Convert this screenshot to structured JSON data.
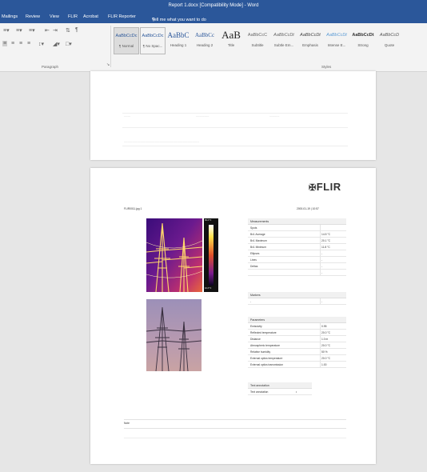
{
  "window": {
    "title": "Report 1.docx [Compatibility Mode] - Word"
  },
  "menu": {
    "items": [
      "Mailings",
      "Review",
      "View",
      "FLIR",
      "Acrobat",
      "FLIR Reporter"
    ],
    "tell_me": "Tell me what you want to do"
  },
  "ribbon": {
    "paragraph_label": "Paragraph",
    "styles_label": "Styles",
    "styles": [
      {
        "sample": "AaBbCcDc",
        "name": "¶ Normal"
      },
      {
        "sample": "AaBbCcDc",
        "name": "¶ No Spac..."
      },
      {
        "sample": "AaBbC",
        "name": "Heading 1"
      },
      {
        "sample": "AaBbCc",
        "name": "Heading 2"
      },
      {
        "sample": "AaB",
        "name": "Title"
      },
      {
        "sample": "AaBbCcC",
        "name": "Subtitle"
      },
      {
        "sample": "AaBbCcDt",
        "name": "Subtle Em..."
      },
      {
        "sample": "AaBbCcDt",
        "name": "Emphasis"
      },
      {
        "sample": "AaBbCcDt",
        "name": "Intense E..."
      },
      {
        "sample": "AaBbCcDt",
        "name": "Strong"
      },
      {
        "sample": "AaBbCcD",
        "name": "Quote"
      }
    ]
  },
  "report": {
    "logo": "FLIR",
    "file_name": "FLIR0011.jpg",
    "page_num": "1",
    "datetime": "2000-01-19 | 10:57",
    "scale_max": "36.4 °C",
    "scale_min": "10.3 °C",
    "measurements": {
      "title": "Measurements",
      "rows": [
        {
          "label": "Spots",
          "value": ""
        },
        {
          "label": "Bx1 Average",
          "value": "14.5 °C"
        },
        {
          "label": "Bx1 Maximum",
          "value": "20.1 °C"
        },
        {
          "label": "Bx1 Minimum",
          "value": "11.8 °C"
        },
        {
          "label": "Ellipses",
          "value": "-"
        },
        {
          "label": "Lines",
          "value": "-"
        },
        {
          "label": "Deltas",
          "value": "-"
        },
        {
          "label": "",
          "value": "-"
        }
      ]
    },
    "markers": {
      "title": "Markers",
      "rows": [
        {
          "label": "-",
          "value": "-"
        }
      ]
    },
    "parameters": {
      "title": "Parameters",
      "rows": [
        {
          "label": "Emissivity",
          "value": "0.95"
        },
        {
          "label": "Reflected temperature",
          "value": "20.0 °C"
        },
        {
          "label": "Distance",
          "value": "1.0 m"
        },
        {
          "label": "Atmospheric temperature",
          "value": "20.0 °C"
        },
        {
          "label": "Relative humidity",
          "value": "50 %"
        },
        {
          "label": "External optics temperature",
          "value": "20.0 °C"
        },
        {
          "label": "External optics transmission",
          "value": "1.00"
        }
      ]
    },
    "text_annotation": {
      "title": "Text annotation",
      "row_label": "Text annotation",
      "row_value": "•"
    },
    "note_label": "Note"
  }
}
